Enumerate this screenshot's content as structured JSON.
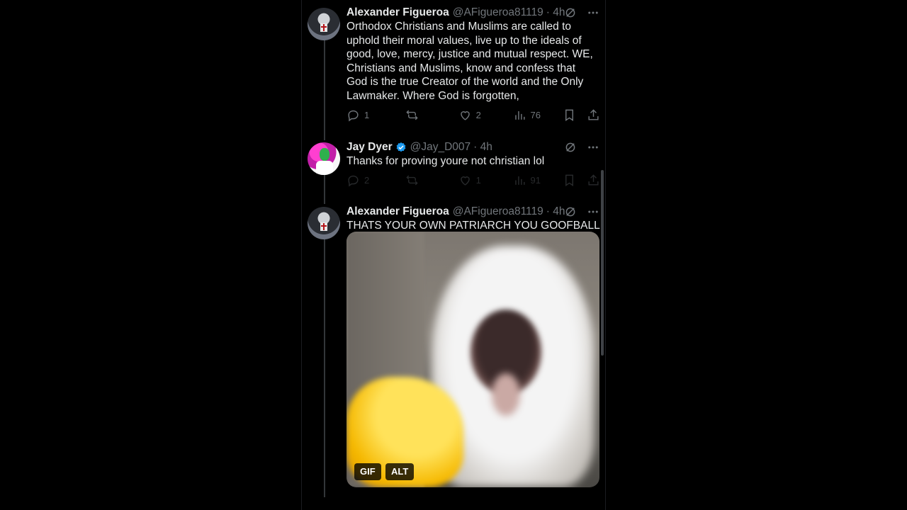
{
  "posts": [
    {
      "author": "Alexander Figueroa",
      "handle": "@AFigueroa81119",
      "time": "· 4h",
      "text": "Orthodox Christians and Muslims are called to uphold their moral values, live up to the ideals of good, love, mercy, justice and mutual respect. WE, Christians and Muslims, know and confess that God is the true Creator of the world and the Only Lawmaker. Where God is forgotten,",
      "replies": "1",
      "reposts": "",
      "likes": "2",
      "views": "76"
    },
    {
      "author": "Jay Dyer",
      "verified": true,
      "handle": "@Jay_D007",
      "time": "· 4h",
      "text": "Thanks for proving youre not christian lol",
      "replies": "2",
      "reposts": "",
      "likes": "1",
      "views": "91"
    },
    {
      "author": "Alexander Figueroa",
      "handle": "@AFigueroa81119",
      "time": "· 4h",
      "text": "THATS YOUR OWN PATRIARCH YOU GOOFBALL",
      "media": {
        "gif_badge": "GIF",
        "alt_badge": "ALT"
      }
    }
  ],
  "colors": {
    "accent": "#1d9bf0",
    "muted": "#71767b",
    "text": "#e7e9ea",
    "background": "#000000"
  },
  "icons": [
    "grok-icon",
    "more-icon",
    "reply-icon",
    "repost-icon",
    "like-icon",
    "views-icon",
    "bookmark-icon",
    "share-icon",
    "verified-badge-icon"
  ]
}
